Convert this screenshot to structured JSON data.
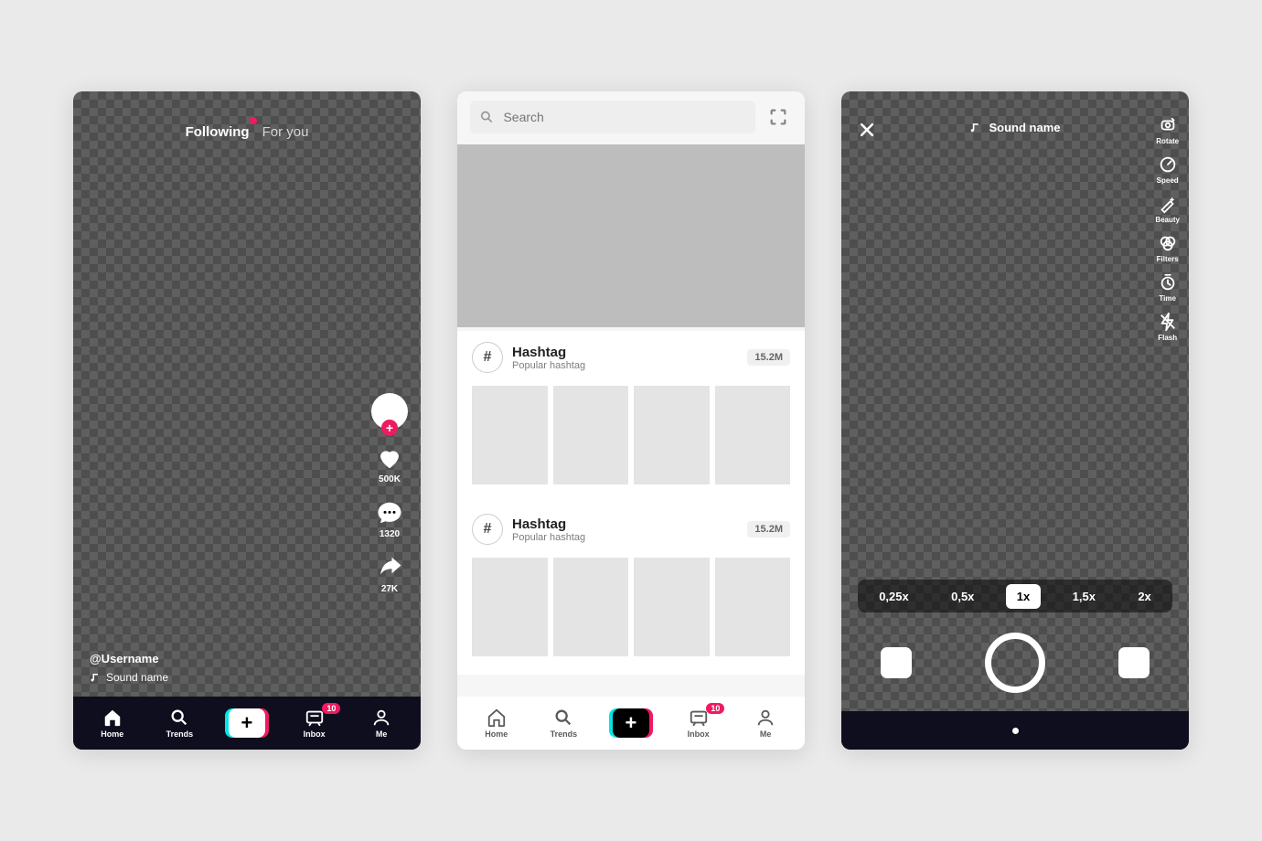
{
  "nav": {
    "home": "Home",
    "trends": "Trends",
    "inbox": "Inbox",
    "me": "Me",
    "inbox_badge": "10"
  },
  "feed": {
    "tab_following": "Following",
    "tab_foryou": "For you",
    "username": "@Username",
    "sound": "Sound name",
    "likes": "500K",
    "comments": "1320",
    "shares": "27K"
  },
  "discover": {
    "search_placeholder": "Search",
    "hashtags": [
      {
        "title": "Hashtag",
        "subtitle": "Popular hashtag",
        "count": "15.2M"
      },
      {
        "title": "Hashtag",
        "subtitle": "Popular hashtag",
        "count": "15.2M"
      }
    ]
  },
  "record": {
    "sound": "Sound name",
    "tools": {
      "rotate": "Rotate",
      "speed": "Speed",
      "beauty": "Beauty",
      "filters": "Filters",
      "time": "Time",
      "flash": "Flash"
    },
    "zoom": [
      "0,25x",
      "0,5x",
      "1x",
      "1,5x",
      "2x"
    ],
    "zoom_active": "1x"
  }
}
